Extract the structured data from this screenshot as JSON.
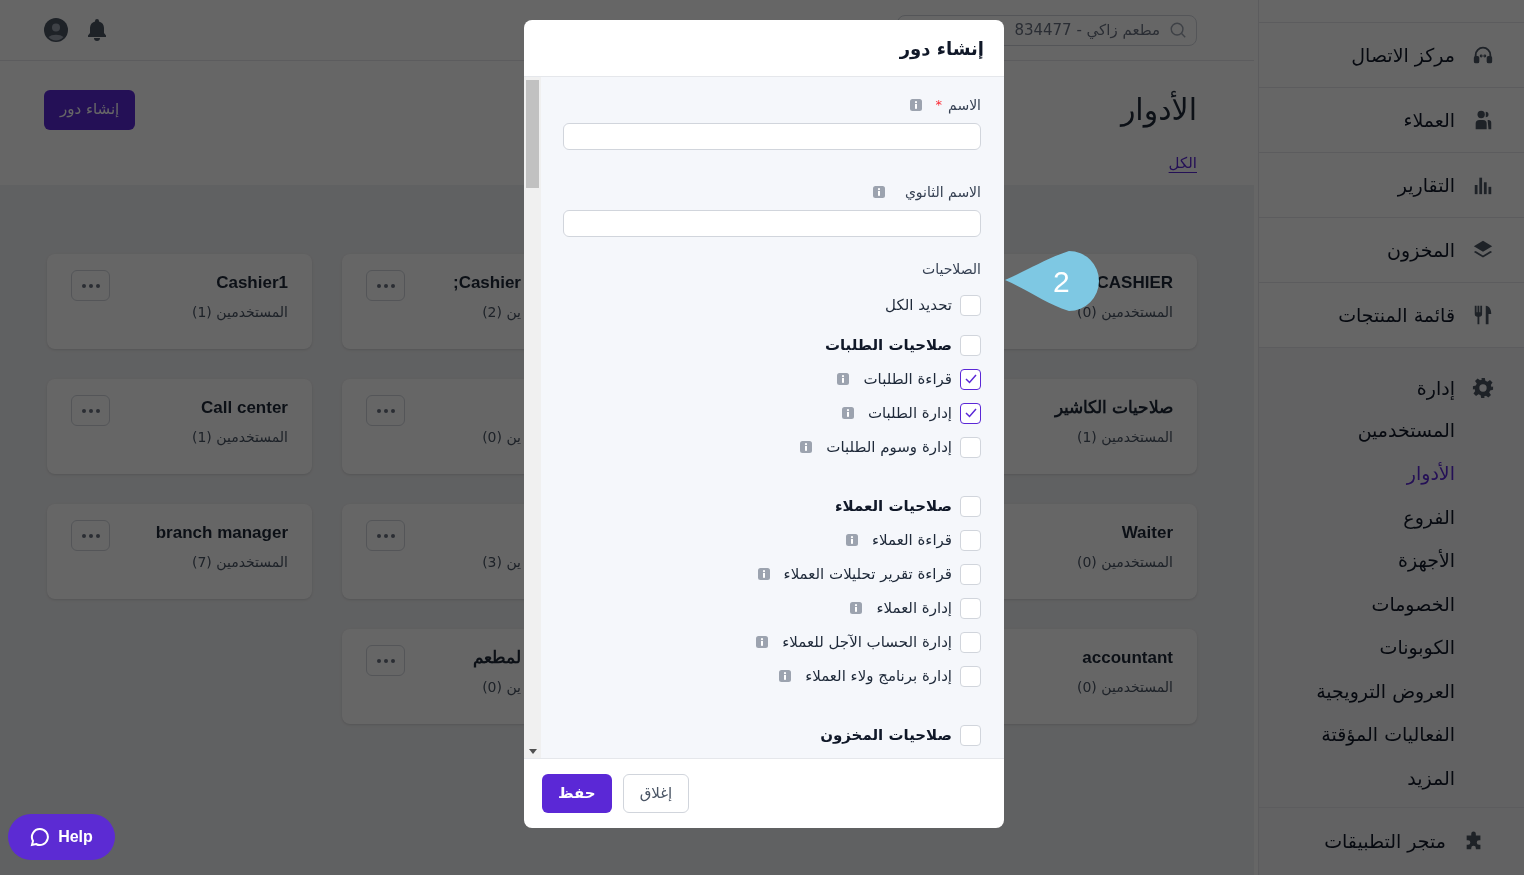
{
  "header": {
    "search": {
      "value": "مطعم زاكي - 834477"
    }
  },
  "page": {
    "title": "الأدوار",
    "create_button": "إنشاء دور",
    "tabs": [
      {
        "label": "الكل",
        "selected": true
      }
    ]
  },
  "role_columns": [
    {
      "cards": [
        {
          "title": "CASHIER",
          "users": "المستخدمين (0)",
          "menu_button": false
        },
        {
          "title": "صلاحيات الكاشير",
          "users": "المستخدمين (1)",
          "menu_button": false
        },
        {
          "title": "Waiter",
          "users": "المستخدمين (0)",
          "menu_button": false
        },
        {
          "title": "accountant",
          "users": "المستخدمين (0)",
          "menu_button": false
        }
      ]
    },
    {
      "cards": [
        {
          "title": "Cashier;",
          "users": "ين (2)",
          "menu_button": true
        },
        {
          "users": "ين (0)",
          "menu_button": true
        },
        {
          "users": "ين (3)",
          "menu_button": true
        },
        {
          "title": "لمطعم",
          "users": "ين (0)",
          "menu_button": true
        }
      ]
    },
    {
      "cards": [
        {
          "title": "Cashier1",
          "users": "المستخدمين (1)",
          "menu_button": true
        },
        {
          "title": "Call center",
          "users": "المستخدمين (1)",
          "menu_button": true
        },
        {
          "title": "branch manager",
          "users": "المستخدمين (7)",
          "menu_button": true
        }
      ]
    }
  ],
  "sidebar": {
    "items": [
      {
        "label": "مركز الاتصال",
        "kind": "headset"
      },
      {
        "label": "العملاء",
        "kind": "users"
      },
      {
        "label": "التقارير",
        "kind": "chart"
      },
      {
        "label": "المخزون",
        "kind": "layers"
      },
      {
        "label": "قائمة المنتجات",
        "kind": "utensils"
      }
    ],
    "section": {
      "label": "إدارة",
      "kind": "gear",
      "children": [
        {
          "label": "المستخدمين",
          "selected": false
        },
        {
          "label": "الأدوار",
          "selected": true
        },
        {
          "label": "الفروع",
          "selected": false
        },
        {
          "label": "الأجهزة",
          "selected": false
        },
        {
          "label": "الخصومات",
          "selected": false
        },
        {
          "label": "الكوبونات",
          "selected": false
        },
        {
          "label": "العروض الترويجية",
          "selected": false
        },
        {
          "label": "الفعاليات المؤقتة",
          "selected": false
        },
        {
          "label": "المزيد",
          "selected": false
        }
      ]
    },
    "footer_item": {
      "label": "متجر التطبيقات",
      "kind": "puzzle"
    }
  },
  "modal": {
    "title": "إنشاء دور",
    "fields": [
      {
        "label": "الاسم",
        "required_mark": "*"
      },
      {
        "label": "الاسم الثانوي"
      }
    ],
    "permissions_label": "الصلاحيات",
    "select_all": {
      "label": "تحديد الكل",
      "checked": false
    },
    "groups": [
      {
        "label": "صلاحيات الطلبات",
        "checked": false,
        "children": [
          {
            "label": "قراءة الطلبات",
            "checked": true
          },
          {
            "label": "إدارة الطلبات",
            "checked": true
          },
          {
            "label": "إدارة وسوم الطلبات",
            "checked": false
          }
        ]
      },
      {
        "label": "صلاحيات العملاء",
        "checked": false,
        "children": [
          {
            "label": "قراءة العملاء",
            "checked": false
          },
          {
            "label": "قراءة تقرير تحليلات العملاء",
            "checked": false
          },
          {
            "label": "إدارة العملاء",
            "checked": false
          },
          {
            "label": "إدارة الحساب الآجل للعملاء",
            "checked": false
          },
          {
            "label": "إدارة برنامج ولاء العملاء",
            "checked": false
          }
        ]
      },
      {
        "label": "صلاحيات المخزون",
        "checked": false
      }
    ],
    "buttons": {
      "save": "حفظ",
      "close": "إغلاق"
    }
  },
  "step_marker": {
    "label": "2"
  },
  "help_button": {
    "label": "Help"
  }
}
